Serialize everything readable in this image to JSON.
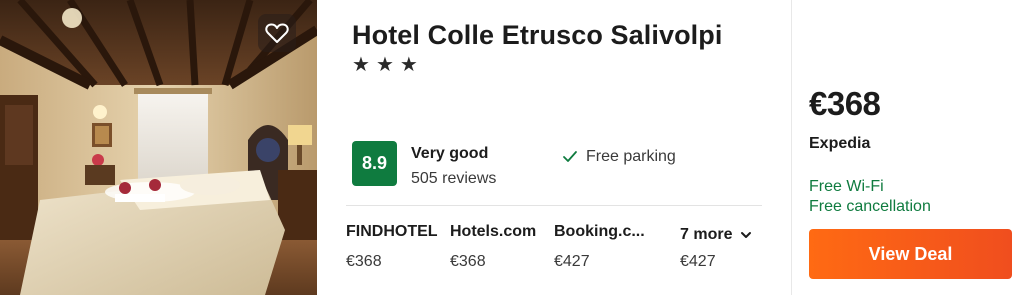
{
  "hotel": {
    "name": "Hotel Colle Etrusco Salivolpi",
    "stars": [
      "★",
      "★",
      "★"
    ]
  },
  "rating": {
    "score": "8.9",
    "label": "Very good",
    "reviews": "505 reviews",
    "badge_color": "#0f7b3f"
  },
  "amenity": {
    "label": "Free parking",
    "icon": "check-icon"
  },
  "providers": [
    {
      "name": "FINDHOTEL",
      "price": "€368"
    },
    {
      "name": "Hotels.com",
      "price": "€368"
    },
    {
      "name": "Booking.c...",
      "price": "€427"
    }
  ],
  "more": {
    "label": "7 more",
    "price": "€427"
  },
  "deal": {
    "price": "€368",
    "source": "Expedia",
    "perks": [
      "Free Wi-Fi",
      "Free cancellation"
    ],
    "button_label": "View Deal",
    "accent": "#ff6a13"
  },
  "favorite_icon": "heart-icon"
}
